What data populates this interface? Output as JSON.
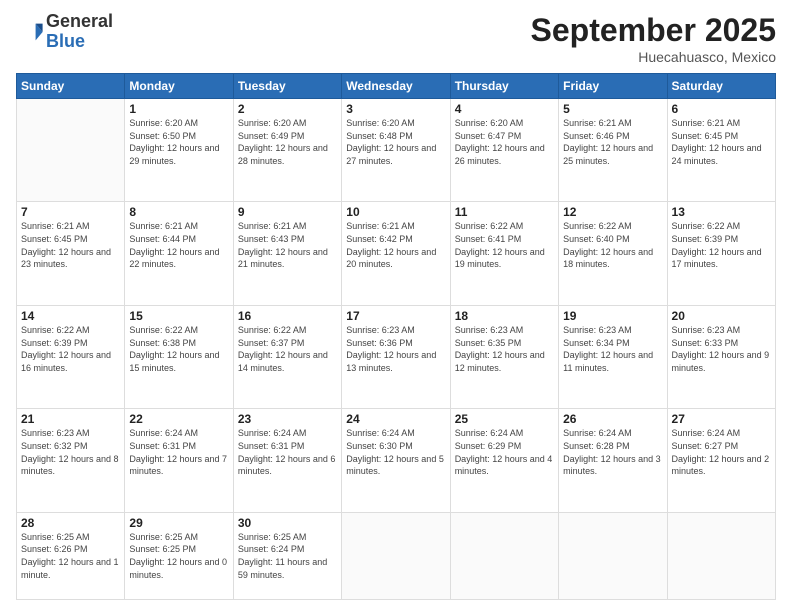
{
  "header": {
    "logo_general": "General",
    "logo_blue": "Blue",
    "month_year": "September 2025",
    "location": "Huecahuasco, Mexico"
  },
  "weekdays": [
    "Sunday",
    "Monday",
    "Tuesday",
    "Wednesday",
    "Thursday",
    "Friday",
    "Saturday"
  ],
  "weeks": [
    [
      {
        "day": "",
        "sunrise": "",
        "sunset": "",
        "daylight": ""
      },
      {
        "day": "1",
        "sunrise": "Sunrise: 6:20 AM",
        "sunset": "Sunset: 6:50 PM",
        "daylight": "Daylight: 12 hours and 29 minutes."
      },
      {
        "day": "2",
        "sunrise": "Sunrise: 6:20 AM",
        "sunset": "Sunset: 6:49 PM",
        "daylight": "Daylight: 12 hours and 28 minutes."
      },
      {
        "day": "3",
        "sunrise": "Sunrise: 6:20 AM",
        "sunset": "Sunset: 6:48 PM",
        "daylight": "Daylight: 12 hours and 27 minutes."
      },
      {
        "day": "4",
        "sunrise": "Sunrise: 6:20 AM",
        "sunset": "Sunset: 6:47 PM",
        "daylight": "Daylight: 12 hours and 26 minutes."
      },
      {
        "day": "5",
        "sunrise": "Sunrise: 6:21 AM",
        "sunset": "Sunset: 6:46 PM",
        "daylight": "Daylight: 12 hours and 25 minutes."
      },
      {
        "day": "6",
        "sunrise": "Sunrise: 6:21 AM",
        "sunset": "Sunset: 6:45 PM",
        "daylight": "Daylight: 12 hours and 24 minutes."
      }
    ],
    [
      {
        "day": "7",
        "sunrise": "Sunrise: 6:21 AM",
        "sunset": "Sunset: 6:45 PM",
        "daylight": "Daylight: 12 hours and 23 minutes."
      },
      {
        "day": "8",
        "sunrise": "Sunrise: 6:21 AM",
        "sunset": "Sunset: 6:44 PM",
        "daylight": "Daylight: 12 hours and 22 minutes."
      },
      {
        "day": "9",
        "sunrise": "Sunrise: 6:21 AM",
        "sunset": "Sunset: 6:43 PM",
        "daylight": "Daylight: 12 hours and 21 minutes."
      },
      {
        "day": "10",
        "sunrise": "Sunrise: 6:21 AM",
        "sunset": "Sunset: 6:42 PM",
        "daylight": "Daylight: 12 hours and 20 minutes."
      },
      {
        "day": "11",
        "sunrise": "Sunrise: 6:22 AM",
        "sunset": "Sunset: 6:41 PM",
        "daylight": "Daylight: 12 hours and 19 minutes."
      },
      {
        "day": "12",
        "sunrise": "Sunrise: 6:22 AM",
        "sunset": "Sunset: 6:40 PM",
        "daylight": "Daylight: 12 hours and 18 minutes."
      },
      {
        "day": "13",
        "sunrise": "Sunrise: 6:22 AM",
        "sunset": "Sunset: 6:39 PM",
        "daylight": "Daylight: 12 hours and 17 minutes."
      }
    ],
    [
      {
        "day": "14",
        "sunrise": "Sunrise: 6:22 AM",
        "sunset": "Sunset: 6:39 PM",
        "daylight": "Daylight: 12 hours and 16 minutes."
      },
      {
        "day": "15",
        "sunrise": "Sunrise: 6:22 AM",
        "sunset": "Sunset: 6:38 PM",
        "daylight": "Daylight: 12 hours and 15 minutes."
      },
      {
        "day": "16",
        "sunrise": "Sunrise: 6:22 AM",
        "sunset": "Sunset: 6:37 PM",
        "daylight": "Daylight: 12 hours and 14 minutes."
      },
      {
        "day": "17",
        "sunrise": "Sunrise: 6:23 AM",
        "sunset": "Sunset: 6:36 PM",
        "daylight": "Daylight: 12 hours and 13 minutes."
      },
      {
        "day": "18",
        "sunrise": "Sunrise: 6:23 AM",
        "sunset": "Sunset: 6:35 PM",
        "daylight": "Daylight: 12 hours and 12 minutes."
      },
      {
        "day": "19",
        "sunrise": "Sunrise: 6:23 AM",
        "sunset": "Sunset: 6:34 PM",
        "daylight": "Daylight: 12 hours and 11 minutes."
      },
      {
        "day": "20",
        "sunrise": "Sunrise: 6:23 AM",
        "sunset": "Sunset: 6:33 PM",
        "daylight": "Daylight: 12 hours and 9 minutes."
      }
    ],
    [
      {
        "day": "21",
        "sunrise": "Sunrise: 6:23 AM",
        "sunset": "Sunset: 6:32 PM",
        "daylight": "Daylight: 12 hours and 8 minutes."
      },
      {
        "day": "22",
        "sunrise": "Sunrise: 6:24 AM",
        "sunset": "Sunset: 6:31 PM",
        "daylight": "Daylight: 12 hours and 7 minutes."
      },
      {
        "day": "23",
        "sunrise": "Sunrise: 6:24 AM",
        "sunset": "Sunset: 6:31 PM",
        "daylight": "Daylight: 12 hours and 6 minutes."
      },
      {
        "day": "24",
        "sunrise": "Sunrise: 6:24 AM",
        "sunset": "Sunset: 6:30 PM",
        "daylight": "Daylight: 12 hours and 5 minutes."
      },
      {
        "day": "25",
        "sunrise": "Sunrise: 6:24 AM",
        "sunset": "Sunset: 6:29 PM",
        "daylight": "Daylight: 12 hours and 4 minutes."
      },
      {
        "day": "26",
        "sunrise": "Sunrise: 6:24 AM",
        "sunset": "Sunset: 6:28 PM",
        "daylight": "Daylight: 12 hours and 3 minutes."
      },
      {
        "day": "27",
        "sunrise": "Sunrise: 6:24 AM",
        "sunset": "Sunset: 6:27 PM",
        "daylight": "Daylight: 12 hours and 2 minutes."
      }
    ],
    [
      {
        "day": "28",
        "sunrise": "Sunrise: 6:25 AM",
        "sunset": "Sunset: 6:26 PM",
        "daylight": "Daylight: 12 hours and 1 minute."
      },
      {
        "day": "29",
        "sunrise": "Sunrise: 6:25 AM",
        "sunset": "Sunset: 6:25 PM",
        "daylight": "Daylight: 12 hours and 0 minutes."
      },
      {
        "day": "30",
        "sunrise": "Sunrise: 6:25 AM",
        "sunset": "Sunset: 6:24 PM",
        "daylight": "Daylight: 11 hours and 59 minutes."
      },
      {
        "day": "",
        "sunrise": "",
        "sunset": "",
        "daylight": ""
      },
      {
        "day": "",
        "sunrise": "",
        "sunset": "",
        "daylight": ""
      },
      {
        "day": "",
        "sunrise": "",
        "sunset": "",
        "daylight": ""
      },
      {
        "day": "",
        "sunrise": "",
        "sunset": "",
        "daylight": ""
      }
    ]
  ]
}
